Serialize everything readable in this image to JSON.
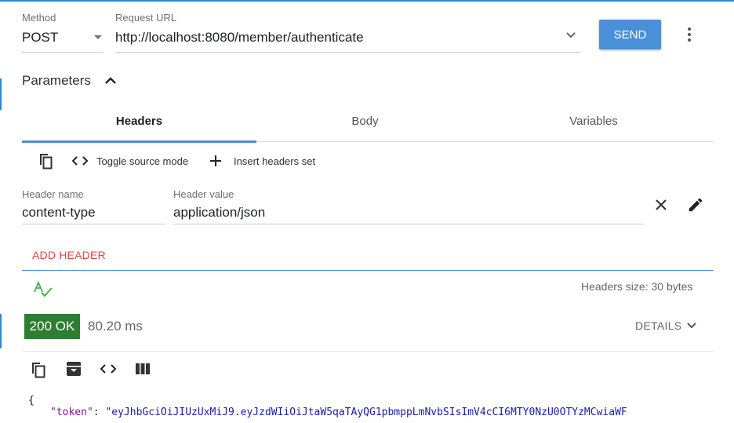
{
  "request": {
    "method_label": "Method",
    "method_value": "POST",
    "url_label": "Request URL",
    "url_value": "http://localhost:8080/member/authenticate",
    "send_label": "SEND"
  },
  "parameters": {
    "title": "Parameters"
  },
  "tabs": [
    {
      "label": "Headers",
      "active": true
    },
    {
      "label": "Body",
      "active": false
    },
    {
      "label": "Variables",
      "active": false
    }
  ],
  "toolbar": {
    "toggle_source_label": "Toggle source mode",
    "insert_headers_label": "Insert headers set"
  },
  "header_row": {
    "name_label": "Header name",
    "name_value": "content-type",
    "value_label": "Header value",
    "value_value": "application/json"
  },
  "add_header_label": "ADD HEADER",
  "headers_size": "Headers size: 30 bytes",
  "response": {
    "status": "200 OK",
    "status_color": "#2e7d32",
    "time": "80.20 ms",
    "details_label": "DETAILS",
    "json_open": "{",
    "token_key": "\"token\"",
    "token_sep": ": ",
    "token_value": "\"eyJhbGciOiJIUzUxMiJ9.eyJzdWIiOiJtaW5qaTAyQG1pbmppLmNvbSIsImV4cCI6MTY0NzU0OTYzMCwiaWF"
  },
  "accent_color": "#4a90d9"
}
